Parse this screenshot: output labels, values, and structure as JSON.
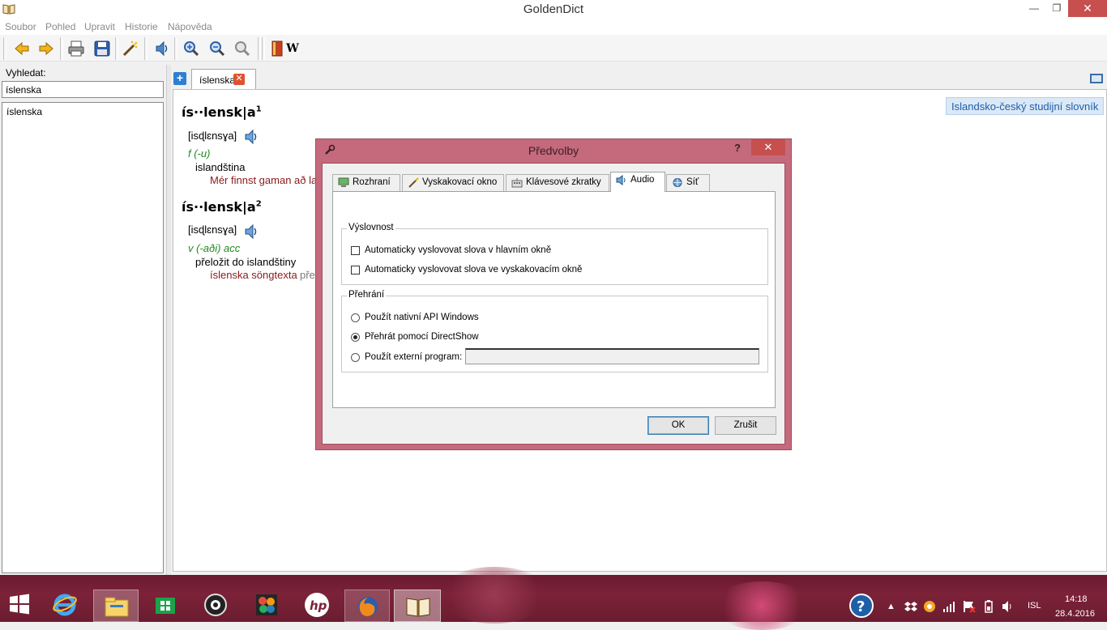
{
  "window": {
    "title": "GoldenDict",
    "menu": [
      "Soubor",
      "Pohled",
      "Upravit",
      "Historie",
      "Nápověda"
    ],
    "minimize_glyph": "—",
    "maximize_glyph": "❐",
    "close_glyph": "✕"
  },
  "toolbar": {
    "buttons": [
      "back-icon",
      "forward-icon",
      "print-icon",
      "save-icon",
      "scan-popup-icon",
      "pronounce-icon",
      "zoom-in-icon",
      "zoom-out-icon",
      "zoom-reset-icon",
      "dictionary-group-icon",
      "wikipedia-icon"
    ],
    "wiki_glyph": "W"
  },
  "lookup": {
    "label": "Vyhledat:",
    "value": "íslenska",
    "results": [
      "íslenska"
    ]
  },
  "tabs": [
    {
      "label": "íslenska",
      "close_glyph": "✕"
    }
  ],
  "article": {
    "dictionary_name": "Islandsko-český studijní slovník",
    "entries": [
      {
        "headword": "ís··lensk|a",
        "homonym": "1",
        "transcription": "[isɖlɛnsɣa]",
        "grammar": "f (-u)",
        "sense": "islandština",
        "example": "Mér finnst gaman að la",
        "example_translation": ""
      },
      {
        "headword": "ís··lensk|a",
        "homonym": "2",
        "transcription": "[isɖlɛnsɣa]",
        "grammar": "v (-aði) acc",
        "sense": "přeložit do islandštiny",
        "example": "íslenska söngtexta",
        "example_translation": "přel"
      }
    ]
  },
  "dialog": {
    "title": "Předvolby",
    "help_glyph": "?",
    "close_glyph": "✕",
    "tabs": [
      {
        "label": "Rozhraní",
        "icon": "monitor-icon"
      },
      {
        "label": "Vyskakovací okno",
        "icon": "magic-wand-icon"
      },
      {
        "label": "Klávesové zkratky",
        "icon": "keyboard-icon"
      },
      {
        "label": "Audio",
        "icon": "speaker-icon",
        "active": true
      },
      {
        "label": "Síť",
        "icon": "network-icon"
      }
    ],
    "pronunciation": {
      "title": "Výslovnost",
      "options": [
        {
          "label": "Automaticky vyslovovat slova v hlavním okně",
          "checked": false
        },
        {
          "label": "Automaticky vyslovovat slova ve vyskakovacím okně",
          "checked": false
        }
      ]
    },
    "playback": {
      "title": "Přehrání",
      "options": [
        {
          "label": "Použít nativní API Windows",
          "selected": false
        },
        {
          "label": "Přehrát pomocí DirectShow",
          "selected": true
        },
        {
          "label": "Použít externí program:",
          "selected": false
        }
      ],
      "external_program_value": ""
    },
    "ok_label": "OK",
    "cancel_label": "Zrušit"
  },
  "taskbar": {
    "apps": [
      "windows-start-icon",
      "internet-explorer-icon",
      "file-explorer-icon",
      "windows-store-icon",
      "camera-app-icon",
      "photo-app-icon",
      "hp-icon",
      "firefox-icon",
      "goldendict-icon"
    ],
    "tray": {
      "language": "ISL",
      "time": "14:18",
      "date": "28.4.2016"
    }
  },
  "colors": {
    "accent_taskbar": "#7c2238",
    "dialog_frame": "#c5697c",
    "close_red": "#c7504f",
    "grammar_green": "#1f8a1f",
    "example_red": "#8b1a1a",
    "dict_badge_blue": "#1f5fa8"
  }
}
